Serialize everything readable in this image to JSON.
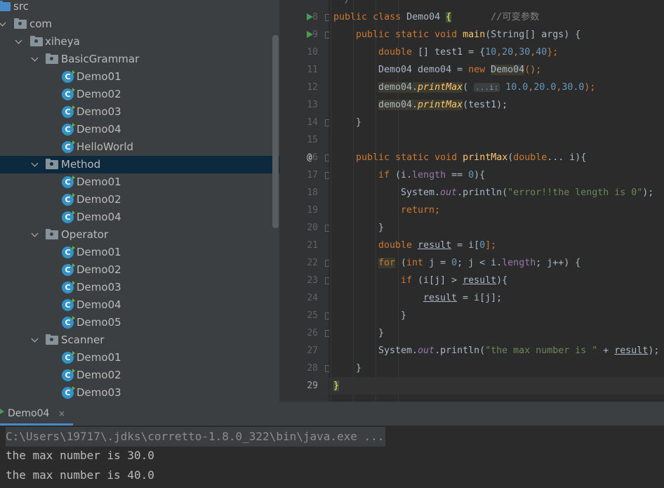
{
  "project_tree": {
    "items": [
      {
        "label": "src",
        "kind": "folder-src"
      },
      {
        "label": "com",
        "kind": "package"
      },
      {
        "label": "xiheya",
        "kind": "package"
      },
      {
        "label": "BasicGrammar",
        "kind": "package"
      },
      {
        "label": "Demo01",
        "kind": "class"
      },
      {
        "label": "Demo02",
        "kind": "class"
      },
      {
        "label": "Demo03",
        "kind": "class"
      },
      {
        "label": "Demo04",
        "kind": "class"
      },
      {
        "label": "HelloWorld",
        "kind": "class"
      },
      {
        "label": "Method",
        "kind": "package",
        "selected": true
      },
      {
        "label": "Demo01",
        "kind": "class"
      },
      {
        "label": "Demo02",
        "kind": "class"
      },
      {
        "label": "Demo04",
        "kind": "class"
      },
      {
        "label": "Operator",
        "kind": "package"
      },
      {
        "label": "Demo01",
        "kind": "class"
      },
      {
        "label": "Demo02",
        "kind": "class"
      },
      {
        "label": "Demo03",
        "kind": "class"
      },
      {
        "label": "Demo04",
        "kind": "class"
      },
      {
        "label": "Demo05",
        "kind": "class"
      },
      {
        "label": "Scanner",
        "kind": "package"
      },
      {
        "label": "Demo01",
        "kind": "class"
      },
      {
        "label": "Demo02",
        "kind": "class"
      },
      {
        "label": "Demo03",
        "kind": "class"
      }
    ],
    "class_icon_letter": "C"
  },
  "editor": {
    "line_numbers": [
      "8",
      "9",
      "10",
      "11",
      "12",
      "13",
      "14",
      "15",
      "16",
      "17",
      "18",
      "19",
      "20",
      "21",
      "22",
      "23",
      "24",
      "25",
      "26",
      "27",
      "28",
      "29"
    ],
    "current_line": "29",
    "lines": {
      "l0": "*/",
      "l8": {
        "k1": "public",
        "k2": "class",
        "name": "Demo04",
        "brace": "{",
        "comment": "//可变参数"
      },
      "l9": {
        "k1": "public",
        "k2": "static",
        "k3": "void",
        "name": "main",
        "rest": "(String[] args) {"
      },
      "l10": {
        "k1": "double",
        "a": " [] test1 = {",
        "n1": "10",
        "c1": ",",
        "n2": "20",
        "c2": ",",
        "n3": "30",
        "c3": ",",
        "n4": "40",
        "e": "};"
      },
      "l11": {
        "a": "Demo04 demo04 = ",
        "k1": "new",
        "cls": "Demo04",
        "e": "();"
      },
      "l12": {
        "obj": "demo04.",
        "m": "printMax",
        "p": "(",
        "hint": "...i:",
        "v1": "10.0",
        "c1": ",",
        "v2": "20.0",
        "c2": ",",
        "v3": "30.0",
        "e": ");"
      },
      "l13": {
        "obj": "demo04.",
        "m": "printMax",
        "e": "(test1);"
      },
      "l14": "}",
      "l16": {
        "k1": "public",
        "k2": "static",
        "k3": "void",
        "name": "printMax",
        "p": "(",
        "k4": "double",
        "rest": "... i){"
      },
      "l17": {
        "k1": "if",
        "a": " (i.",
        "f": "length",
        "b": " == ",
        "n": "0",
        "e": "){"
      },
      "l18": {
        "a": "System.",
        "f": "out",
        "b": ".println(",
        "s": "\"error!!the length is 0\"",
        "e": ");"
      },
      "l19": {
        "k1": "return",
        "e": ";"
      },
      "l20": "}",
      "l21": {
        "k1": "double",
        "sp": " ",
        "v": "result",
        "a": " = i[",
        "n": "0",
        "e": "];"
      },
      "l22": {
        "k1": "for",
        "a": " (",
        "k2": "int",
        "b": " j = ",
        "n": "0",
        "c": "; j < i.",
        "f": "length",
        "e": "; j++) {"
      },
      "l23": {
        "k1": "if",
        "a": " (i[j] > ",
        "v": "result",
        "e": "){"
      },
      "l24": {
        "v": "result",
        "e": " = i[j];"
      },
      "l25": "}",
      "l26": "}",
      "l27": {
        "a": "System.",
        "f": "out",
        "b": ".println(",
        "s": "\"the max number is \"",
        "c": " + ",
        "v": "result",
        "e": ");"
      },
      "l28": "}",
      "l29": "}"
    }
  },
  "run_panel": {
    "tab_label": "Demo04",
    "close_glyph": "×",
    "output": [
      "C:\\Users\\19717\\.jdks\\corretto-1.8.0_322\\bin\\java.exe ...",
      "the max number is 30.0",
      "the max number is 40.0"
    ]
  },
  "colors": {
    "keyword": "#cc7832",
    "method": "#ffc66d",
    "number": "#6897bb",
    "string": "#6a8759",
    "field": "#9876aa",
    "selection": "#0d293e",
    "run_green": "#499c54",
    "class_icon": "#3592c4"
  }
}
